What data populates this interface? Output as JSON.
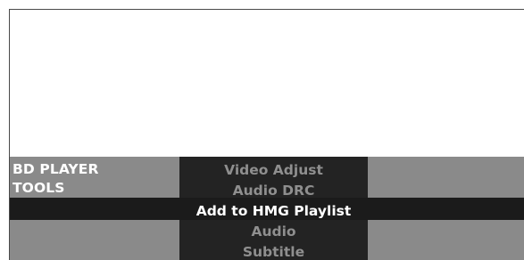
{
  "panel": {
    "title_line1": "BD PLAYER",
    "title_line2": "TOOLS"
  },
  "menu": {
    "items": [
      {
        "label": "Video Adjust",
        "selected": false
      },
      {
        "label": "Audio DRC",
        "selected": false
      },
      {
        "label": "Add to HMG Playlist",
        "selected": true
      },
      {
        "label": "Audio",
        "selected": false
      },
      {
        "label": "Subtitle",
        "selected": false
      }
    ]
  },
  "colors": {
    "background": "#ffffff",
    "side_panel": "#8a8a8a",
    "menu_column": "#232323",
    "selected_bar": "#1b1b1b",
    "text_active": "#ffffff",
    "text_inactive": "#8f8f8f"
  }
}
